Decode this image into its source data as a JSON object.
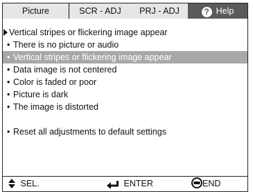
{
  "tabs": {
    "picture": "Picture",
    "scr_adj": "SCR - ADJ",
    "prj_adj": "PRJ - ADJ",
    "help": "Help"
  },
  "breadcrumb": "Vertical stripes or flickering image appear",
  "menu": {
    "items": [
      "There is no picture or audio",
      "Vertical stripes or flickering image appear",
      "Data image is not centered",
      "Color is faded or poor",
      "Picture is dark",
      "The image is distorted"
    ],
    "selected_index": 1,
    "reset": "Reset all adjustments to default settings"
  },
  "footer": {
    "sel": "SEL.",
    "enter": "ENTER",
    "end": "END"
  },
  "icons": {
    "help": "question-circle-icon",
    "sel": "up-down-arrows-icon",
    "enter": "enter-arrow-icon",
    "end": "end-button-icon"
  },
  "colors": {
    "selected_row": "#a8a8a8",
    "active_tab": "#5a5a5a",
    "inactive_tab": "#e6e6e6"
  }
}
